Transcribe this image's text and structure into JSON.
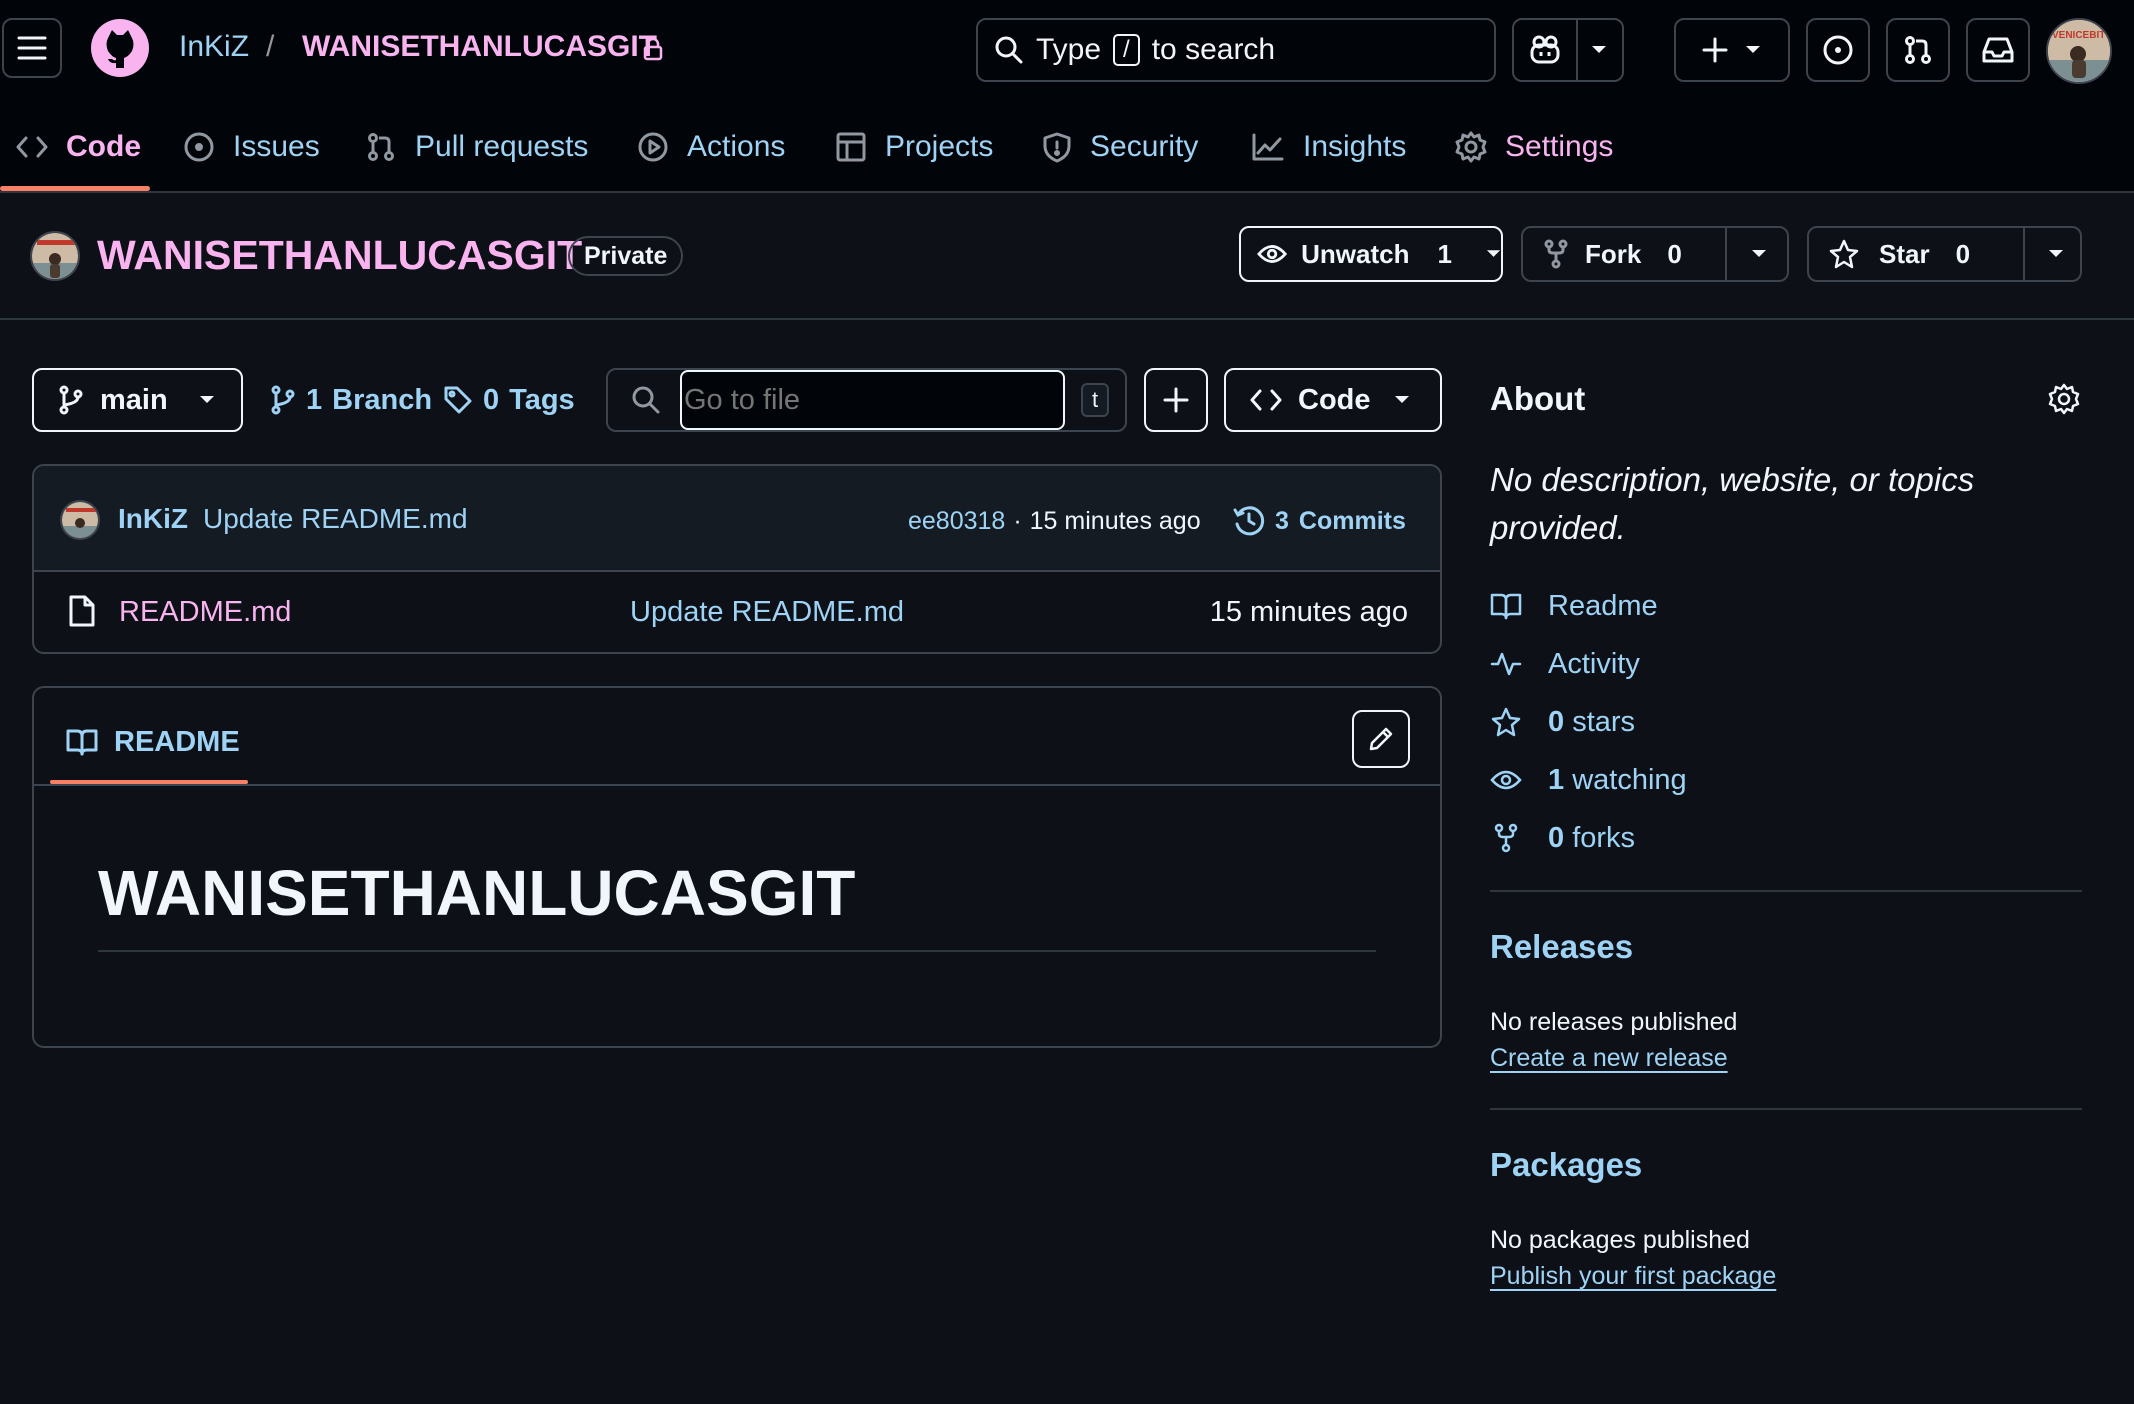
{
  "header": {
    "owner": "InKiZ",
    "separator": "/",
    "repo": "WANISETHANLUCASGIT",
    "search": {
      "prefix": "Type",
      "key": "/",
      "suffix": "to search"
    },
    "avatar_text": "VENICEBITCH"
  },
  "nav": {
    "tabs": [
      {
        "label": "Code",
        "icon": "code-icon",
        "active": true
      },
      {
        "label": "Issues",
        "icon": "issue-icon"
      },
      {
        "label": "Pull requests",
        "icon": "pull-request-icon"
      },
      {
        "label": "Actions",
        "icon": "play-icon"
      },
      {
        "label": "Projects",
        "icon": "table-icon"
      },
      {
        "label": "Security",
        "icon": "shield-icon"
      },
      {
        "label": "Insights",
        "icon": "graph-icon"
      },
      {
        "label": "Settings",
        "icon": "gear-icon"
      }
    ]
  },
  "repo": {
    "name": "WANISETHANLUCASGIT",
    "visibility": "Private",
    "unwatch": {
      "label": "Unwatch",
      "count": "1"
    },
    "fork": {
      "label": "Fork",
      "count": "0"
    },
    "star": {
      "label": "Star",
      "count": "0"
    }
  },
  "toolbar": {
    "branch": "main",
    "branches": {
      "count": "1",
      "label": "Branch"
    },
    "tags": {
      "count": "0",
      "label": "Tags"
    },
    "goto_placeholder": "Go to file",
    "goto_key": "t",
    "code_button": "Code"
  },
  "commit": {
    "author": "InKiZ",
    "message": "Update README.md",
    "sha": "ee80318",
    "dot": "·",
    "time": "15 minutes ago",
    "commits_count": "3",
    "commits_label": "Commits"
  },
  "files": [
    {
      "name": "README.md",
      "message": "Update README.md",
      "time": "15 minutes ago",
      "icon": "file-icon"
    }
  ],
  "readme": {
    "tab_label": "README",
    "heading": "WANISETHANLUCASGIT"
  },
  "about": {
    "title": "About",
    "description": "No description, website, or topics provided.",
    "links": [
      {
        "icon": "book-icon",
        "count": "",
        "label": "Readme"
      },
      {
        "icon": "pulse-icon",
        "count": "",
        "label": "Activity"
      },
      {
        "icon": "star-icon",
        "count": "0",
        "label": "stars"
      },
      {
        "icon": "eye-icon",
        "count": "1",
        "label": "watching"
      },
      {
        "icon": "fork-icon",
        "count": "0",
        "label": "forks"
      }
    ]
  },
  "releases": {
    "title": "Releases",
    "empty": "No releases published",
    "link": "Create a new release"
  },
  "packages": {
    "title": "Packages",
    "empty": "No packages published",
    "link": "Publish your first package"
  },
  "colors": {
    "background": "#0d1117",
    "header": "#010409",
    "link": "#9fd3f5",
    "accent_pink": "#f9b4f0",
    "active_underline": "#f78166",
    "border": "#3d444d"
  }
}
